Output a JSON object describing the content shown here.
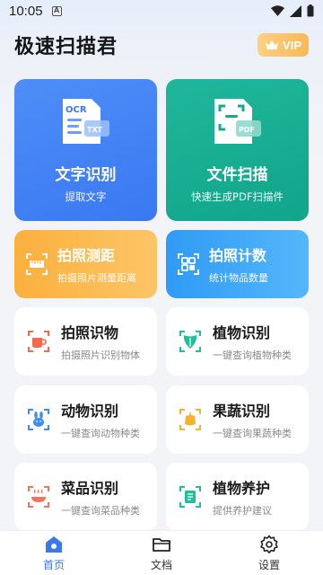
{
  "status": {
    "time": "10:05"
  },
  "header": {
    "title": "极速扫描君",
    "vip_label": "VIP"
  },
  "big_cards": [
    {
      "title": "文字识别",
      "subtitle": "提取文字",
      "icon_text_top": "OCR",
      "icon_text_badge": "TXT"
    },
    {
      "title": "文件扫描",
      "subtitle": "快速生成PDF扫描件",
      "icon_text_badge": "PDF"
    }
  ],
  "mid_cards": [
    {
      "title": "拍照测距",
      "subtitle": "拍摄照片测量距离"
    },
    {
      "title": "拍照计数",
      "subtitle": "统计物品数量"
    }
  ],
  "small_cards": [
    {
      "title": "拍照识物",
      "subtitle": "拍摄照片识别物体"
    },
    {
      "title": "植物识别",
      "subtitle": "一键查询植物种类"
    },
    {
      "title": "动物识别",
      "subtitle": "一键查询动物种类"
    },
    {
      "title": "果蔬识别",
      "subtitle": "一键查询果蔬种类"
    },
    {
      "title": "菜品识别",
      "subtitle": "一键查询菜品种类"
    },
    {
      "title": "植物养护",
      "subtitle": "提供养护建议"
    }
  ],
  "bottom_nav": [
    {
      "label": "首页",
      "active": true
    },
    {
      "label": "文档",
      "active": false
    },
    {
      "label": "设置",
      "active": false
    }
  ],
  "colors": {
    "accent": "#3a78f2",
    "vip": "#f7b955"
  }
}
